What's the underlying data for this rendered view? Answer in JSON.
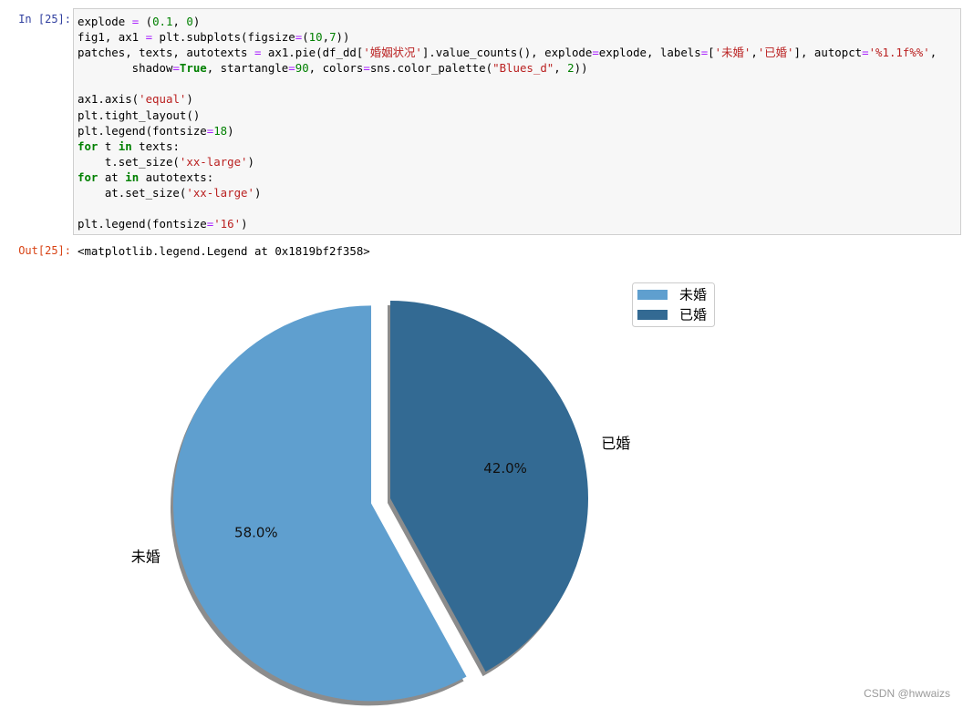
{
  "notebook": {
    "in_prompt": "In  [25]:",
    "out_prompt": "Out[25]:",
    "output_text": "<matplotlib.legend.Legend at 0x1819bf2f358>",
    "code_lines": [
      [
        [
          "explode ",
          ""
        ],
        [
          "=",
          "op"
        ],
        [
          " (",
          ""
        ],
        [
          "0.1",
          "num"
        ],
        [
          ", ",
          ""
        ],
        [
          "0",
          "num"
        ],
        [
          ")",
          ""
        ]
      ],
      [
        [
          "fig1, ax1 ",
          ""
        ],
        [
          "=",
          "op"
        ],
        [
          " plt.subplots(figsize",
          ""
        ],
        [
          "=",
          "op"
        ],
        [
          "(",
          ""
        ],
        [
          "10",
          "num"
        ],
        [
          ",",
          ""
        ],
        [
          "7",
          "num"
        ],
        [
          "))",
          ""
        ]
      ],
      [
        [
          "patches, texts, autotexts ",
          ""
        ],
        [
          "=",
          "op"
        ],
        [
          " ax1.pie(df_dd[",
          ""
        ],
        [
          "'婚姻状况'",
          "str"
        ],
        [
          "].value_counts(), explode",
          ""
        ],
        [
          "=",
          "op"
        ],
        [
          "explode, labels",
          ""
        ],
        [
          "=",
          "op"
        ],
        [
          "[",
          ""
        ],
        [
          "'未婚'",
          "str"
        ],
        [
          ",",
          ""
        ],
        [
          "'已婚'",
          "str"
        ],
        [
          "], autopct",
          ""
        ],
        [
          "=",
          "op"
        ],
        [
          "'%1.1f%%'",
          "str"
        ],
        [
          ",",
          ""
        ]
      ],
      [
        [
          "        shadow",
          ""
        ],
        [
          "=",
          "op"
        ],
        [
          "True",
          "kw"
        ],
        [
          ", startangle",
          ""
        ],
        [
          "=",
          "op"
        ],
        [
          "90",
          "num"
        ],
        [
          ", colors",
          ""
        ],
        [
          "=",
          "op"
        ],
        [
          "sns.color_palette(",
          ""
        ],
        [
          "\"Blues_d\"",
          "str"
        ],
        [
          ", ",
          ""
        ],
        [
          "2",
          "num"
        ],
        [
          "))",
          ""
        ]
      ],
      [
        [
          "",
          ""
        ]
      ],
      [
        [
          "ax1.axis(",
          ""
        ],
        [
          "'equal'",
          "str"
        ],
        [
          ")",
          ""
        ]
      ],
      [
        [
          "plt.tight_layout()",
          ""
        ]
      ],
      [
        [
          "plt.legend(fontsize",
          ""
        ],
        [
          "=",
          "op"
        ],
        [
          "18",
          "num"
        ],
        [
          ")",
          ""
        ]
      ],
      [
        [
          "for",
          "kw"
        ],
        [
          " t ",
          ""
        ],
        [
          "in",
          "kw"
        ],
        [
          " texts:",
          ""
        ]
      ],
      [
        [
          "    t.set_size(",
          ""
        ],
        [
          "'xx-large'",
          "str"
        ],
        [
          ")",
          ""
        ]
      ],
      [
        [
          "for",
          "kw"
        ],
        [
          " at ",
          ""
        ],
        [
          "in",
          "kw"
        ],
        [
          " autotexts:",
          ""
        ]
      ],
      [
        [
          "    at.set_size(",
          ""
        ],
        [
          "'xx-large'",
          "str"
        ],
        [
          ")",
          ""
        ]
      ],
      [
        [
          "",
          ""
        ]
      ],
      [
        [
          "plt.legend(fontsize",
          ""
        ],
        [
          "=",
          "op"
        ],
        [
          "'16'",
          "str"
        ],
        [
          ")",
          ""
        ]
      ]
    ]
  },
  "chart_data": {
    "type": "pie",
    "categories": [
      "未婚",
      "已婚"
    ],
    "values": [
      58.0,
      42.0
    ],
    "autopct_labels": [
      "58.0%",
      "42.0%"
    ],
    "colors": [
      "#5f9fcf",
      "#336a93"
    ],
    "explode": [
      0.1,
      0
    ],
    "startangle": 90,
    "shadow": true,
    "legend": {
      "entries": [
        "未婚",
        "已婚"
      ],
      "placement": "top-right"
    }
  },
  "watermark": "CSDN @hwwaizs"
}
